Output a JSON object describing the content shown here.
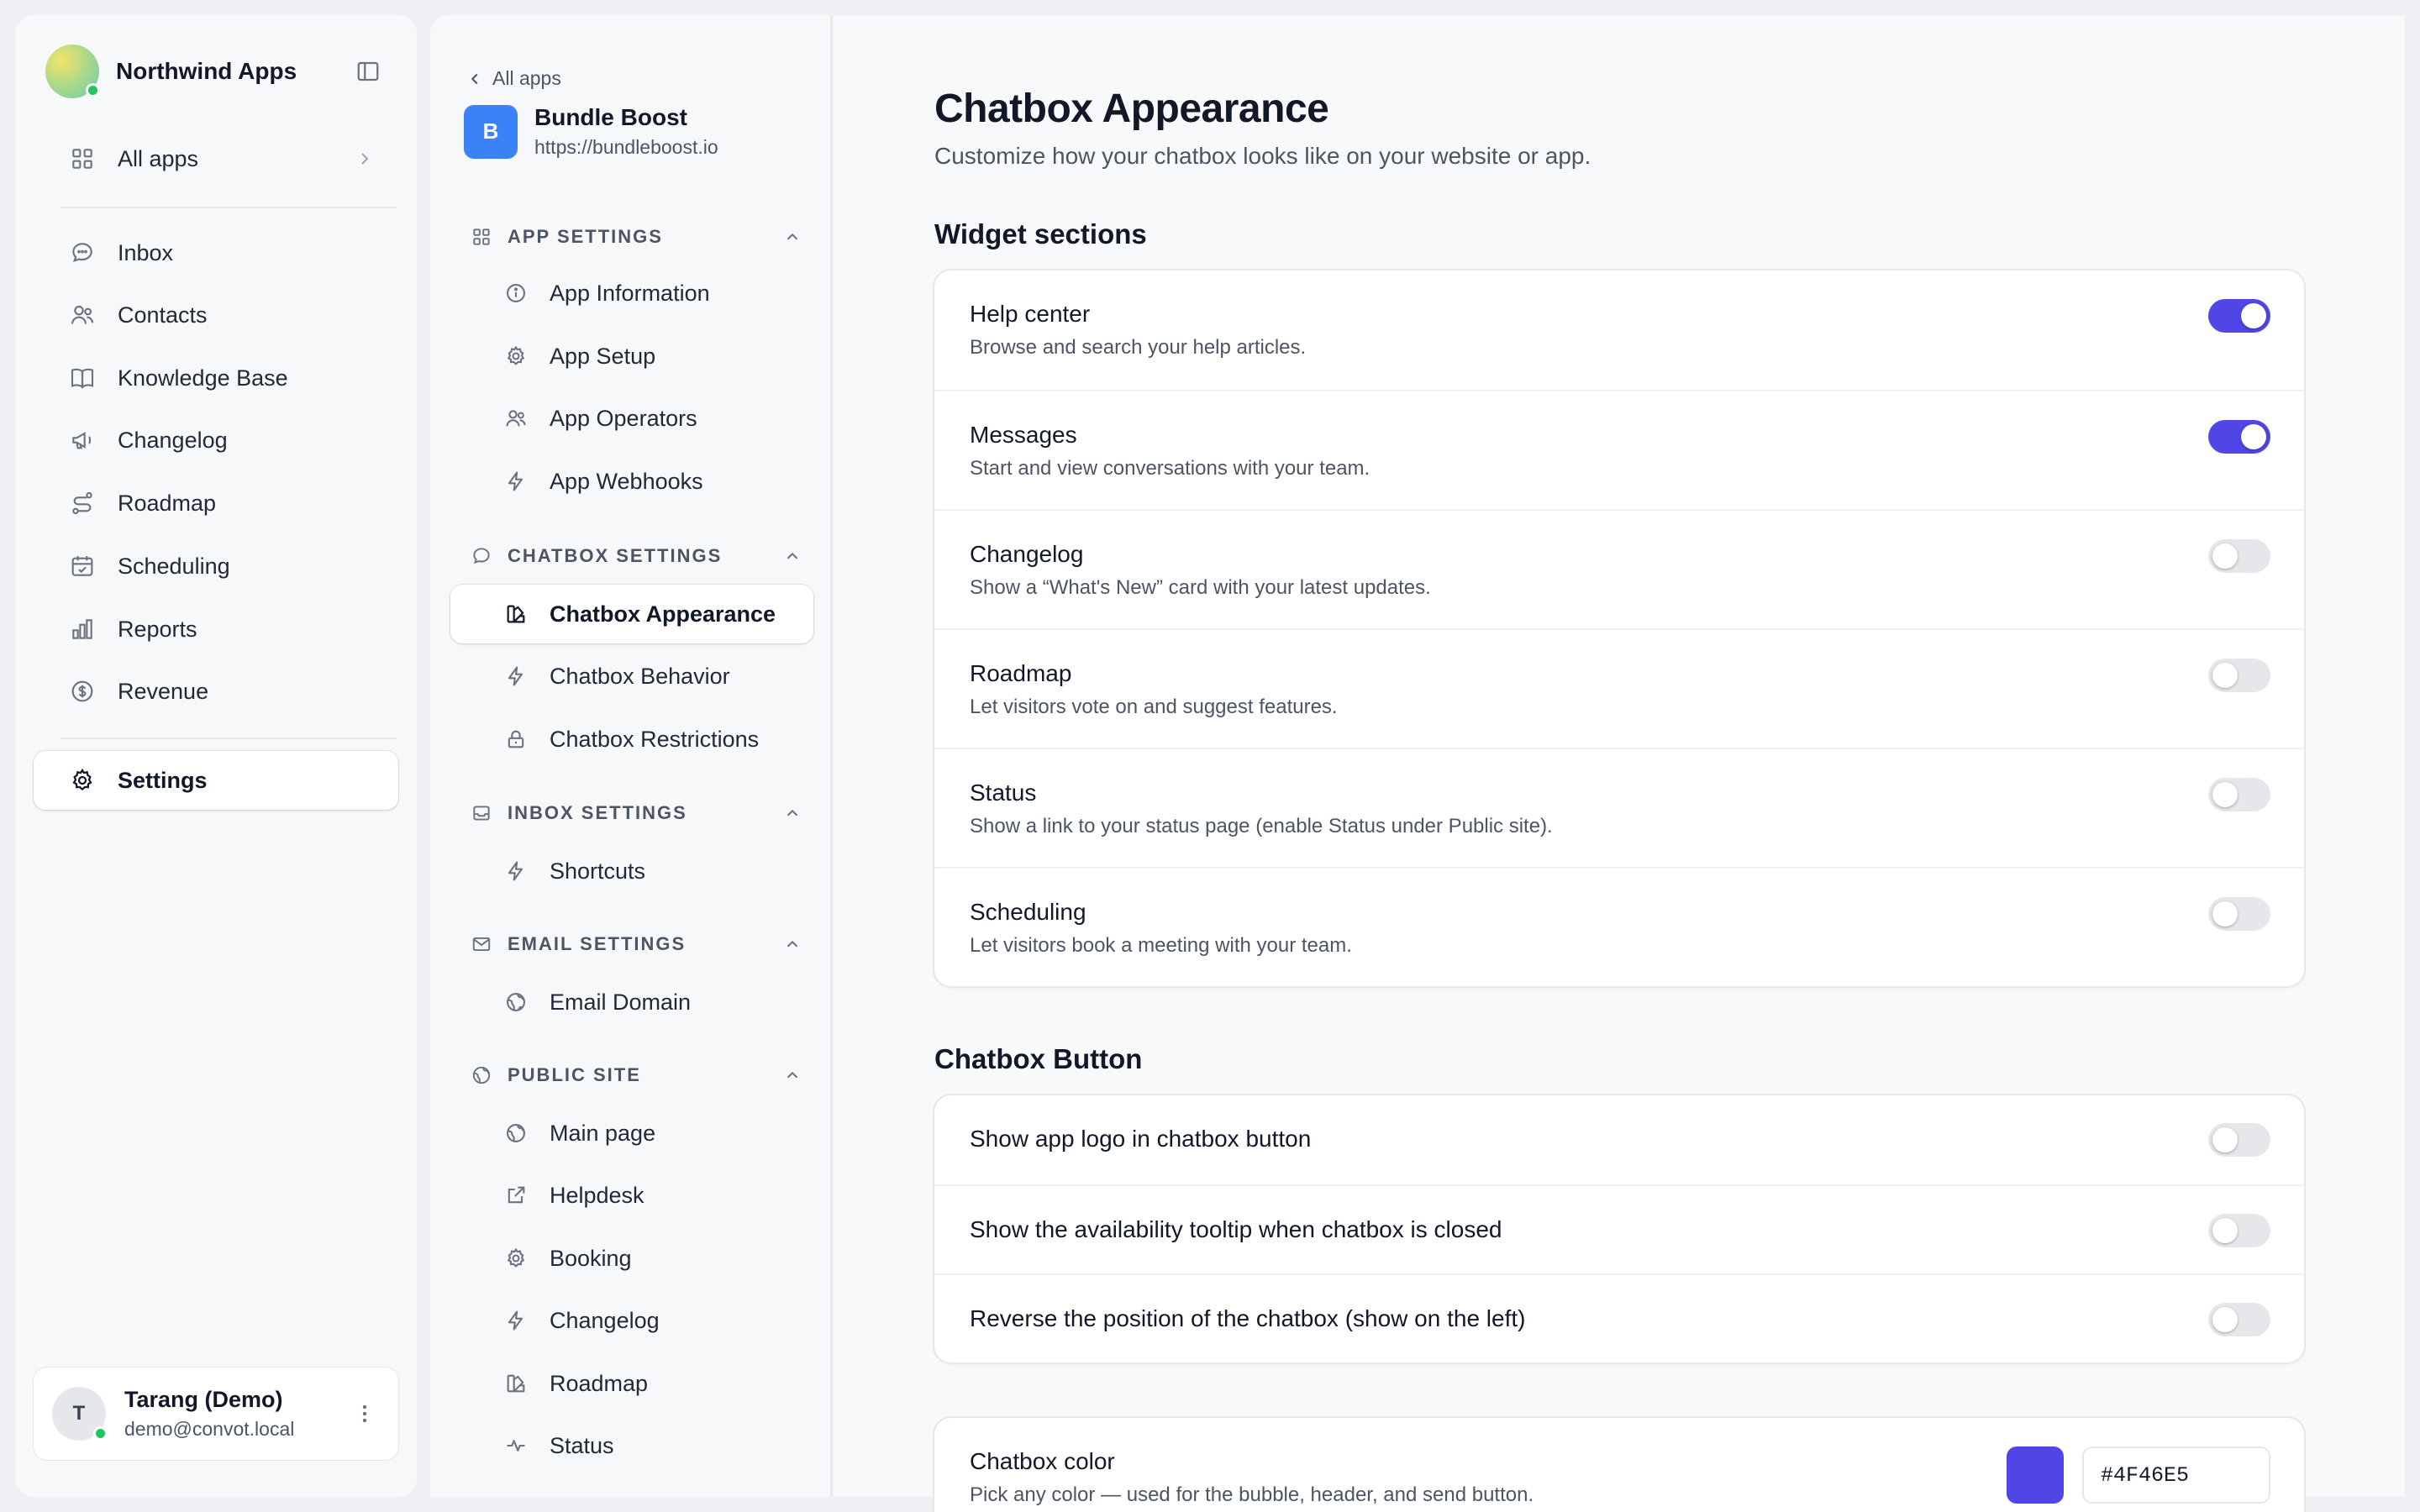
{
  "sidebar": {
    "brand": "Northwind Apps",
    "all_apps": "All apps",
    "items": [
      {
        "label": "Inbox",
        "icon": "chat-bubble-icon"
      },
      {
        "label": "Contacts",
        "icon": "users-icon"
      },
      {
        "label": "Knowledge Base",
        "icon": "book-icon"
      },
      {
        "label": "Changelog",
        "icon": "megaphone-icon"
      },
      {
        "label": "Roadmap",
        "icon": "route-icon"
      },
      {
        "label": "Scheduling",
        "icon": "calendar-check-icon"
      },
      {
        "label": "Reports",
        "icon": "bar-chart-icon"
      },
      {
        "label": "Revenue",
        "icon": "dollar-circle-icon"
      }
    ],
    "settings": "Settings",
    "user": {
      "initial": "T",
      "name": "Tarang (Demo)",
      "email": "demo@convot.local"
    }
  },
  "panel": {
    "back": "All apps",
    "app": {
      "initial": "B",
      "name": "Bundle Boost",
      "url": "https://bundleboost.io"
    },
    "sections": {
      "app_settings": {
        "title": "APP SETTINGS",
        "items": [
          "App Information",
          "App Setup",
          "App Operators",
          "App Webhooks"
        ]
      },
      "chatbox_settings": {
        "title": "CHATBOX SETTINGS",
        "items": [
          "Chatbox Appearance",
          "Chatbox Behavior",
          "Chatbox Restrictions"
        ]
      },
      "inbox_settings": {
        "title": "INBOX SETTINGS",
        "items": [
          "Shortcuts"
        ]
      },
      "email_settings": {
        "title": "EMAIL SETTINGS",
        "items": [
          "Email Domain"
        ]
      },
      "public_site": {
        "title": "PUBLIC SITE",
        "items": [
          "Main page",
          "Helpdesk",
          "Booking",
          "Changelog",
          "Roadmap",
          "Status"
        ]
      }
    }
  },
  "main": {
    "title": "Chatbox Appearance",
    "subtitle": "Customize how your chatbox looks like on your website or app.",
    "widget_sections": {
      "title": "Widget sections",
      "rows": [
        {
          "title": "Help center",
          "desc": "Browse and search your help articles.",
          "on": true
        },
        {
          "title": "Messages",
          "desc": "Start and view conversations with your team.",
          "on": true
        },
        {
          "title": "Changelog",
          "desc": "Show a “What's New” card with your latest updates.",
          "on": false
        },
        {
          "title": "Roadmap",
          "desc": "Let visitors vote on and suggest features.",
          "on": false
        },
        {
          "title": "Status",
          "desc": "Show a link to your status page (enable Status under Public site).",
          "on": false
        },
        {
          "title": "Scheduling",
          "desc": "Let visitors book a meeting with your team.",
          "on": false
        }
      ]
    },
    "chatbox_button": {
      "title": "Chatbox Button",
      "rows": [
        {
          "title": "Show app logo in chatbox button",
          "on": false
        },
        {
          "title": "Show the availability tooltip when chatbox is closed",
          "on": false
        },
        {
          "title": "Reverse the position of the chatbox (show on the left)",
          "on": false
        }
      ]
    },
    "chatbox_color": {
      "title": "Chatbox color",
      "desc": "Pick any color — used for the bubble, header, and send button.",
      "value": "#4F46E5",
      "swatch": "#4f46e5"
    }
  }
}
